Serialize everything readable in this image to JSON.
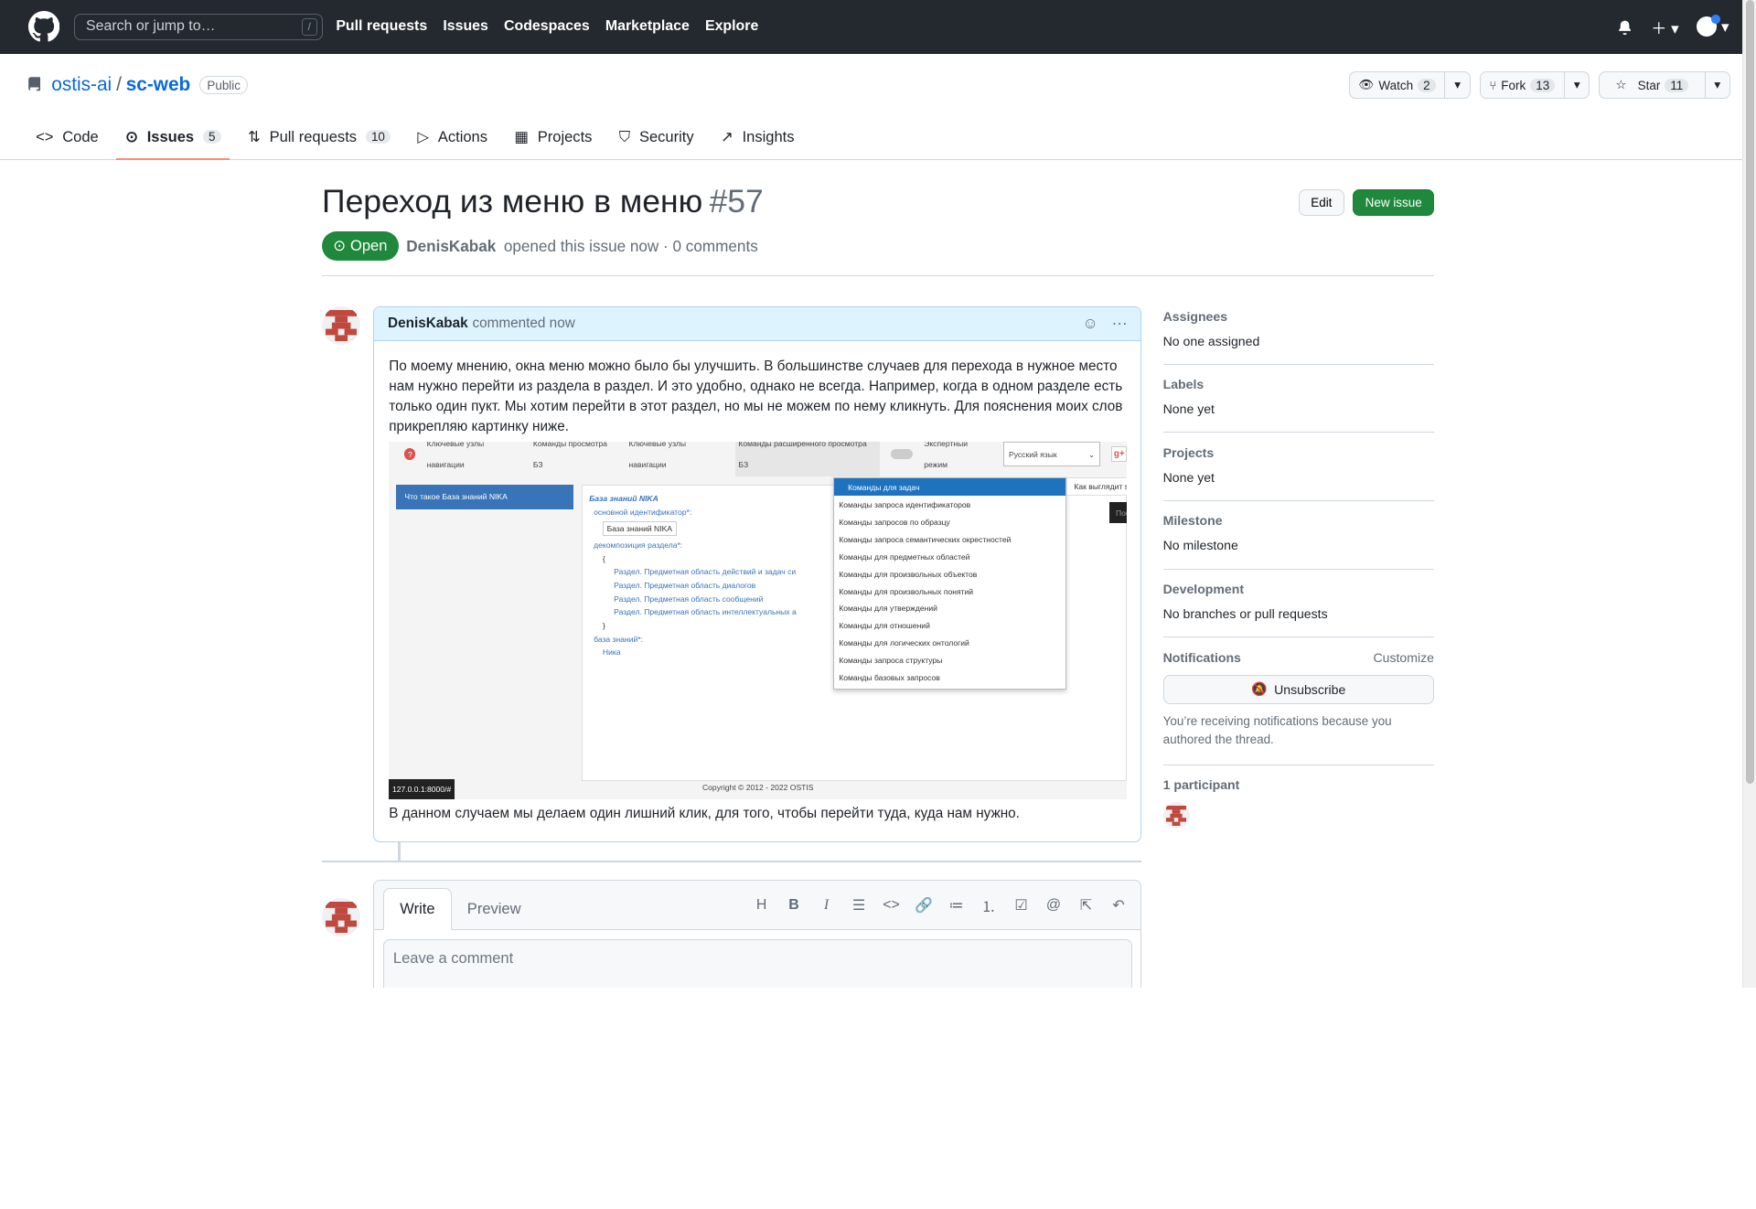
{
  "header": {
    "search_placeholder": "Search or jump to…",
    "search_shortcut": "/",
    "nav": [
      "Pull requests",
      "Issues",
      "Codespaces",
      "Marketplace",
      "Explore"
    ]
  },
  "repo": {
    "owner": "ostis-ai",
    "name": "sc-web",
    "visibility": "Public",
    "watch_label": "Watch",
    "watch_count": "2",
    "fork_label": "Fork",
    "fork_count": "13",
    "star_label": "Star",
    "star_count": "11",
    "tabs": [
      {
        "label": "Code",
        "count": null
      },
      {
        "label": "Issues",
        "count": "5"
      },
      {
        "label": "Pull requests",
        "count": "10"
      },
      {
        "label": "Actions",
        "count": null
      },
      {
        "label": "Projects",
        "count": null
      },
      {
        "label": "Security",
        "count": null
      },
      {
        "label": "Insights",
        "count": null
      }
    ]
  },
  "issue": {
    "title": "Переход из меню в меню",
    "number": "#57",
    "edit_label": "Edit",
    "new_issue_label": "New issue",
    "state": "Open",
    "author": "DenisKabak",
    "meta_text": "opened this issue now · 0 comments"
  },
  "comment": {
    "author": "DenisKabak",
    "when": "commented now",
    "paragraph1": "По моему мнению, окна меню можно было бы улучшить. В большинстве случаев для перехода в нужное место нам нужно перейти из раздела в раздел. И это удобно, однако не всегда. Например, когда в одном разделе есть только один пукт. Мы хотим перейти в этот раздел, но мы не можем по нему кликнуть. Для пояснения моих слов прикрепляю картинку ниже.",
    "paragraph2": "В данном случаем мы делаем один лишний клик, для того, чтобы перейти туда, куда нам нужно."
  },
  "screenshot": {
    "topbar": [
      "Ключевые узлы навигации",
      "Команды просмотра БЗ",
      "Ключевые узлы навигации",
      "Команды расширенного просмотра БЗ",
      "Экспертный режим"
    ],
    "lang": "Русский язык",
    "left_button": "Что такое База знаний NIKA",
    "kb_title": "База знаний NIKA",
    "kb_lines": [
      "основной идентификатор*:",
      "База знаний NIKA",
      "декомпозиция раздела*:",
      "{",
      "Раздел. Предметная область действий и задач си",
      "Раздел. Предметная область диалогов",
      "Раздел. Предметная область сообщений",
      "Раздел. Предметная область интеллектуальных а",
      "}",
      "база знаний*:",
      "Ника"
    ],
    "menu_items": [
      "Команды для задач",
      "Команды запроса идентификаторов",
      "Команды запросов по образцу",
      "Команды запроса семантических окрестностей",
      "Команды для предметных областей",
      "Команды для произвольных объектов",
      "Команды для произвольных понятий",
      "Команды для утверждений",
      "Команды для отношений",
      "Команды для логических онтологий",
      "Команды запроса структуры",
      "Команды базовых запросов"
    ],
    "submenu": "Как выглядит sc-текст решения указываемой зад",
    "search": "Поиск...",
    "copyright": "Copyright © 2012 - 2022 OSTIS",
    "url": "127.0.0.1:8000/#"
  },
  "composer": {
    "write_tab": "Write",
    "preview_tab": "Preview",
    "placeholder": "Leave a comment"
  },
  "sidebar": {
    "assignees_h": "Assignees",
    "assignees_v": "No one assigned",
    "labels_h": "Labels",
    "labels_v": "None yet",
    "projects_h": "Projects",
    "projects_v": "None yet",
    "milestone_h": "Milestone",
    "milestone_v": "No milestone",
    "development_h": "Development",
    "development_v": "No branches or pull requests",
    "notifications_h": "Notifications",
    "customize": "Customize",
    "unsubscribe": "Unsubscribe",
    "notif_note": "You’re receiving notifications because you authored the thread.",
    "participants_h": "1 participant"
  }
}
